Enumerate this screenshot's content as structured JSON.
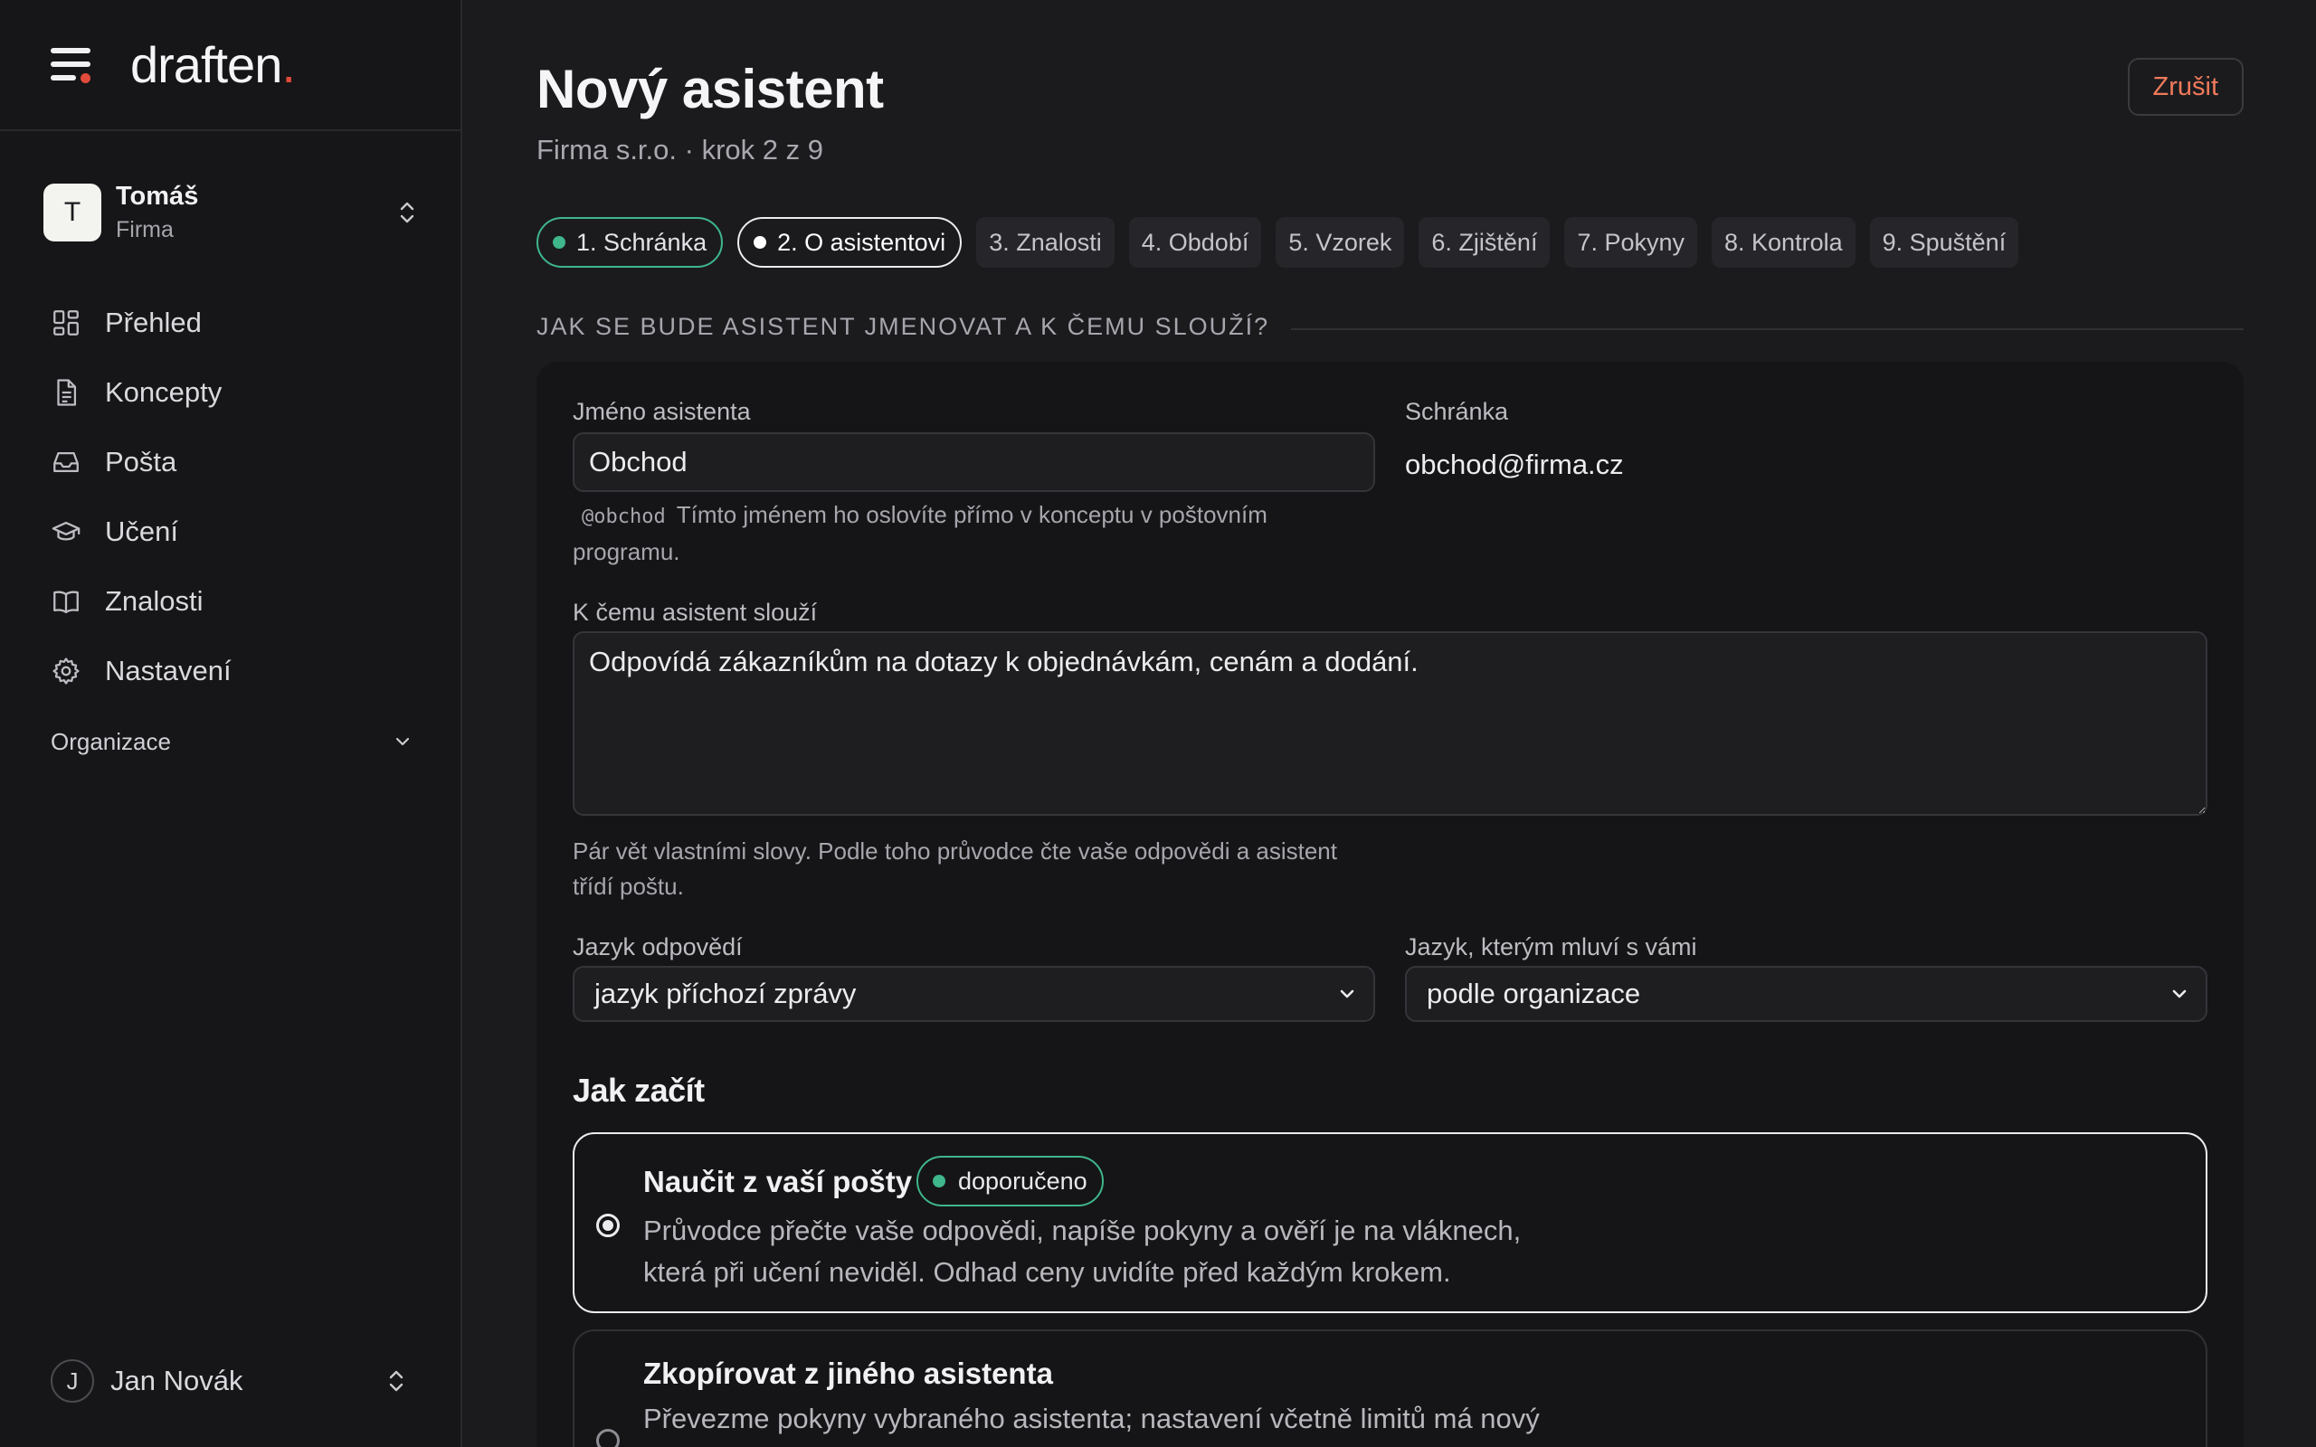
{
  "brand": {
    "name": "draften",
    "dot": "."
  },
  "org": {
    "initial": "T",
    "name": "Tomáš",
    "type": "Firma"
  },
  "nav": [
    {
      "label": "Přehled",
      "icon": "dashboard-icon"
    },
    {
      "label": "Koncepty",
      "icon": "document-icon"
    },
    {
      "label": "Pošta",
      "icon": "inbox-icon"
    },
    {
      "label": "Učení",
      "icon": "graduation-cap-icon"
    },
    {
      "label": "Znalosti",
      "icon": "book-icon"
    },
    {
      "label": "Nastavení",
      "icon": "gear-icon"
    }
  ],
  "org_section": {
    "label": "Organizace"
  },
  "user": {
    "initial": "J",
    "name": "Jan Novák"
  },
  "page": {
    "title": "Nový asistent",
    "subtitle": "Firma s.r.o. · krok 2 z 9",
    "cancel": "Zrušit"
  },
  "steps": [
    {
      "label": "1. Schránka",
      "state": "done"
    },
    {
      "label": "2. O asistentovi",
      "state": "active"
    },
    {
      "label": "3. Znalosti",
      "state": "pending"
    },
    {
      "label": "4. Období",
      "state": "pending"
    },
    {
      "label": "5. Vzorek",
      "state": "pending"
    },
    {
      "label": "6. Zjištění",
      "state": "pending"
    },
    {
      "label": "7. Pokyny",
      "state": "pending"
    },
    {
      "label": "8. Kontrola",
      "state": "pending"
    },
    {
      "label": "9. Spuštění",
      "state": "pending"
    }
  ],
  "section": {
    "title": "JAK SE BUDE ASISTENT JMENOVAT A K ČEMU SLOUŽÍ?"
  },
  "form": {
    "name_label": "Jméno asistenta",
    "name_value": "Obchod",
    "handle": "@obchod",
    "name_hint": "Tímto jménem ho oslovíte přímo v konceptu v poštovním programu.",
    "mailbox_label": "Schránka",
    "mailbox_value": "obchod@firma.cz",
    "purpose_label": "K čemu asistent slouží",
    "purpose_value": "Odpovídá zákazníkům na dotazy k objednávkám, cenám a dodání.",
    "purpose_hint": "Pár vět vlastními slovy. Podle toho průvodce čte vaše odpovědi a asistent třídí poštu.",
    "reply_lang_label": "Jazyk odpovědí",
    "reply_lang_value": "jazyk příchozí zprávy",
    "ui_lang_label": "Jazyk, kterým mluví s vámi",
    "ui_lang_value": "podle organizace"
  },
  "start": {
    "title": "Jak začít",
    "options": [
      {
        "title": "Naučit z vaší pošty",
        "badge": "doporučeno",
        "desc_line1": "Průvodce přečte vaše odpovědi, napíše pokyny a ověří je na vláknech,",
        "desc_line2": "která při učení neviděl. Odhad ceny uvidíte před každým krokem.",
        "selected": true
      },
      {
        "title": "Zkopírovat z jiného asistenta",
        "desc_line1": "Převezme pokyny vybraného asistenta; nastavení včetně limitů má nový",
        "selected": false
      }
    ]
  },
  "colors": {
    "accent_green": "#3fb68b",
    "brand_red": "#e14b3b",
    "cancel_orange": "#f07a5a"
  }
}
